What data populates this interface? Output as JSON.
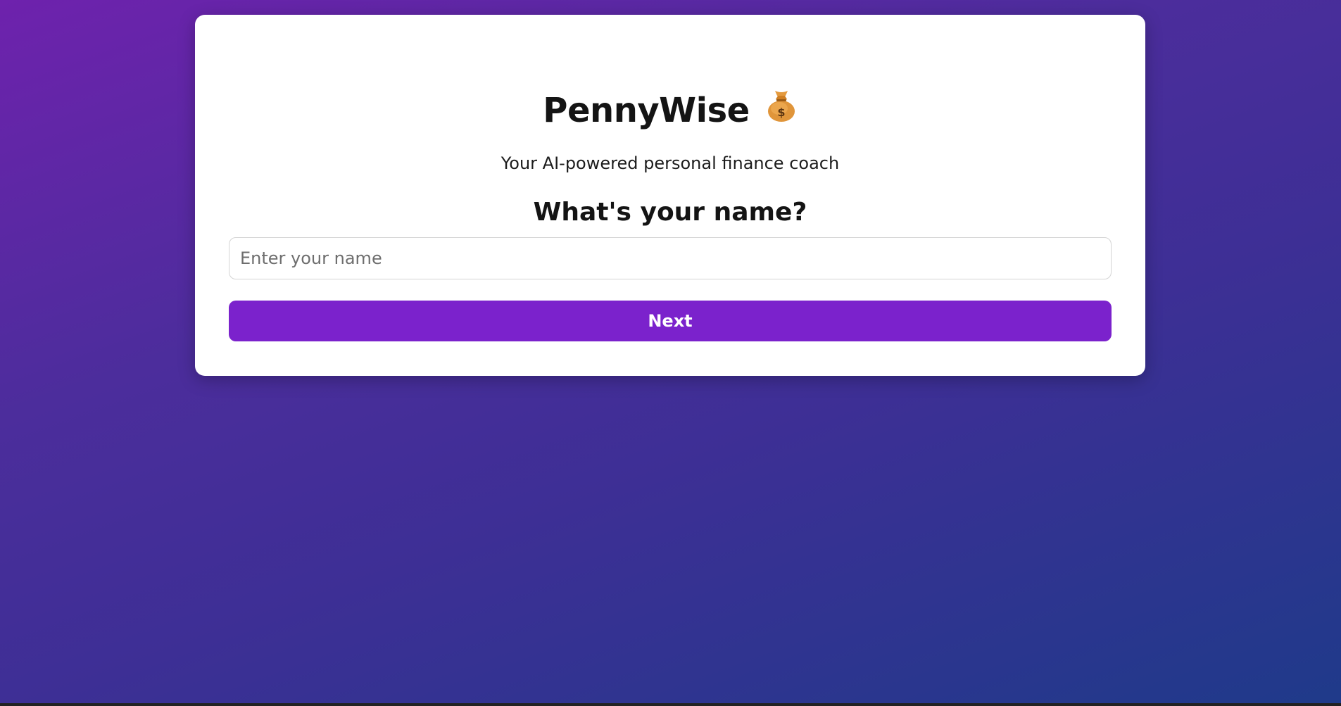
{
  "app": {
    "title": "PennyWise",
    "icon": "money-bag-icon",
    "tagline": "Your AI-powered personal finance coach"
  },
  "form": {
    "question": "What's your name?",
    "name_value": "",
    "name_placeholder": "Enter your name",
    "next_label": "Next"
  },
  "colors": {
    "accent": "#7b22cc",
    "background_start": "#6e22ad",
    "background_end": "#1f3a8a",
    "card": "#ffffff"
  }
}
